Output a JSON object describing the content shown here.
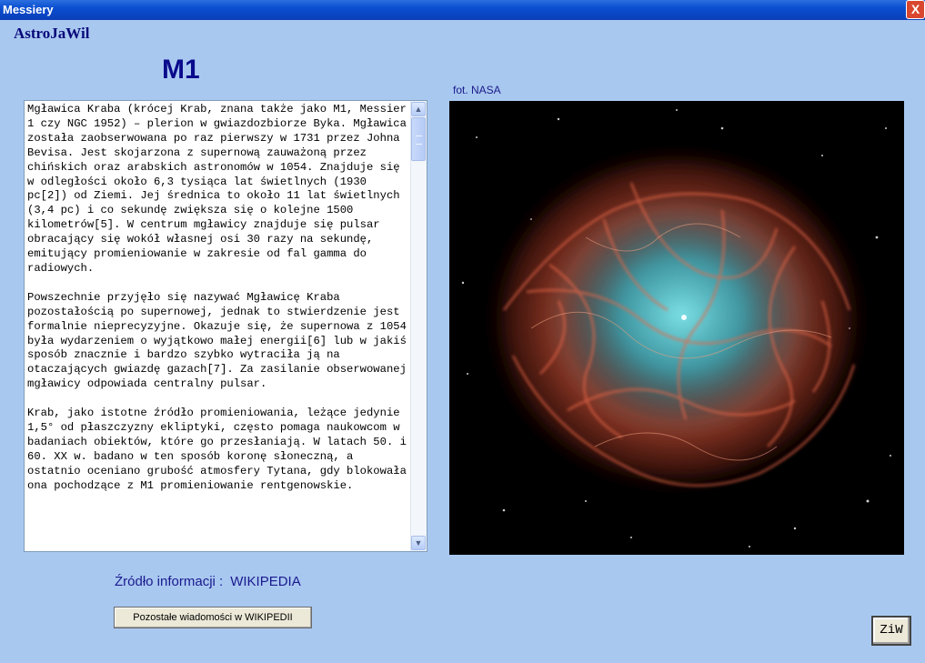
{
  "window": {
    "title": "Messiery",
    "close_label": "X"
  },
  "app": {
    "brand": "AstroJaWil"
  },
  "object": {
    "name": "M1"
  },
  "description": {
    "text": "Mgławica Kraba (krócej Krab, znana także jako M1, Messier 1 czy NGC 1952) – plerion w gwiazdozbiorze Byka. Mgławica została zaobserwowana po raz pierwszy w 1731 przez Johna Bevisa. Jest skojarzona z supernową zauważoną przez chińskich oraz arabskich astronomów w 1054. Znajduje się w odległości około 6,3 tysiąca lat świetlnych (1930 pc[2]) od Ziemi. Jej średnica to około 11 lat świetlnych (3,4 pc) i co sekundę zwiększa się o kolejne 1500 kilometrów[5]. W centrum mgławicy znajduje się pulsar obracający się wokół własnej osi 30 razy na sekundę, emitujący promieniowanie w zakresie od fal gamma do radiowych.\n\nPowszechnie przyjęło się nazywać Mgławicę Kraba pozostałością po supernowej, jednak to stwierdzenie jest formalnie nieprecyzyjne. Okazuje się, że supernowa z 1054 była wydarzeniem o wyjątkowo małej energii[6] lub w jakiś sposób znacznie i bardzo szybko wytraciła ją na otaczających gwiazdę gazach[7]. Za zasilanie obserwowanej mgławicy odpowiada centralny pulsar.\n\nKrab, jako istotne źródło promieniowania, leżące jedynie 1,5° od płaszczyzny ekliptyki, często pomaga naukowcom w badaniach obiektów, które go przesłaniają. W latach 50. i 60. XX w. badano w ten sposób koronę słoneczną, a ostatnio oceniano grubość atmosfery Tytana, gdy blokowała ona pochodzące z M1 promieniowanie rentgenowskie."
  },
  "photo": {
    "credit": "fot. NASA"
  },
  "source": {
    "label": "Źródło informacji :",
    "value": "WIKIPEDIA"
  },
  "buttons": {
    "more": "Pozostałe wiadomości w WIKIPEDII",
    "ziw": "ZiW"
  }
}
